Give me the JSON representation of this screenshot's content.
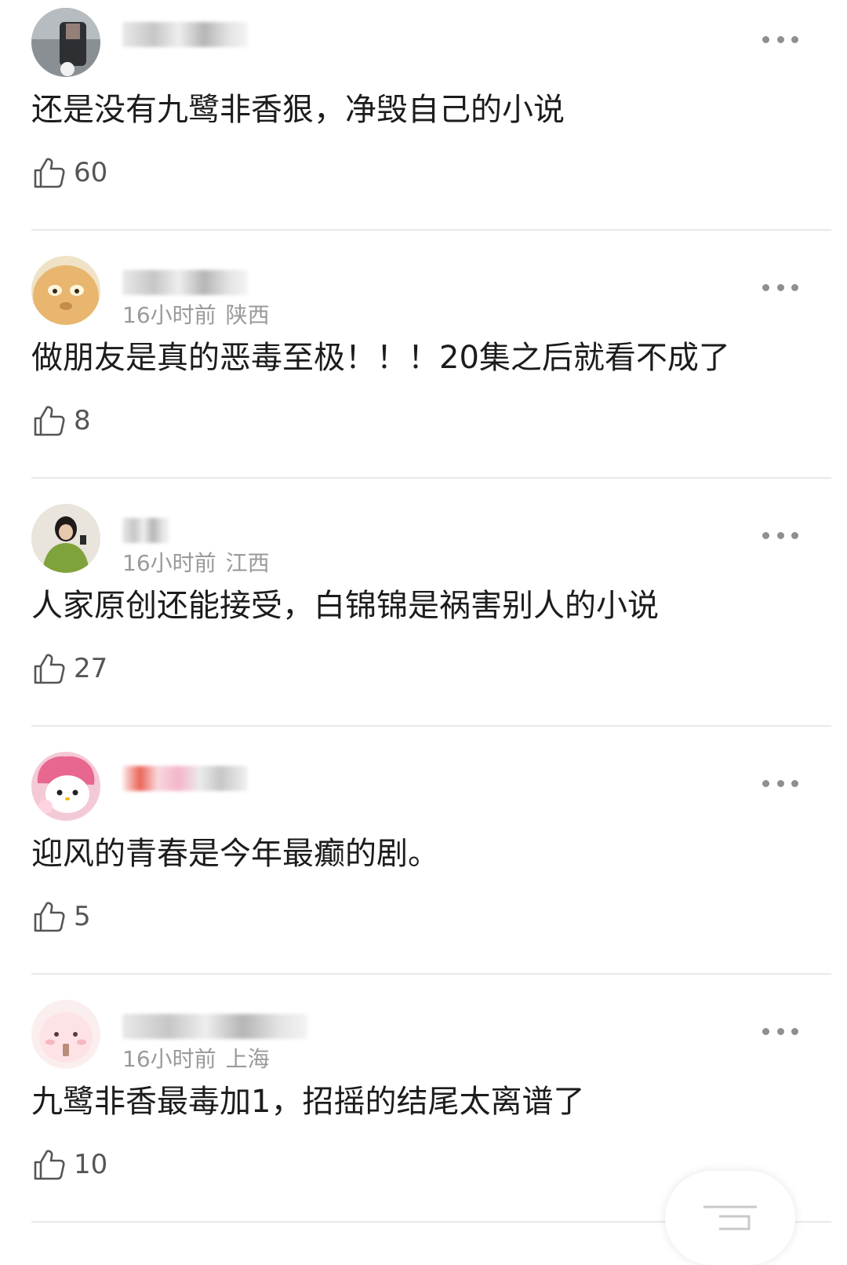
{
  "comments": [
    {
      "username": "",
      "time": "",
      "region": "",
      "text": "还是没有九鹭非香狠，净毁自己的小说",
      "likes": "60"
    },
    {
      "username": "",
      "time": "16小时前",
      "region": "陕西",
      "text": "做朋友是真的恶毒至极！！！20集之后就看不成了",
      "likes": "8"
    },
    {
      "username": "",
      "time": "16小时前",
      "region": "江西",
      "text": "人家原创还能接受，白锦锦是祸害别人的小说",
      "likes": "27"
    },
    {
      "username": "",
      "time": "",
      "region": "",
      "text": "迎风的青春是今年最癫的剧。",
      "likes": "5"
    },
    {
      "username": "",
      "time": "16小时前",
      "region": "上海",
      "text": "九鹭非香最毒加1，招摇的结尾太离谱了",
      "likes": "10"
    }
  ],
  "icons": {
    "like": "thumbs-up-icon",
    "more": "more-dots-icon"
  },
  "colors": {
    "text": "#1c1c1c",
    "meta": "#9a9a9a",
    "divider": "#e9e9e9"
  }
}
